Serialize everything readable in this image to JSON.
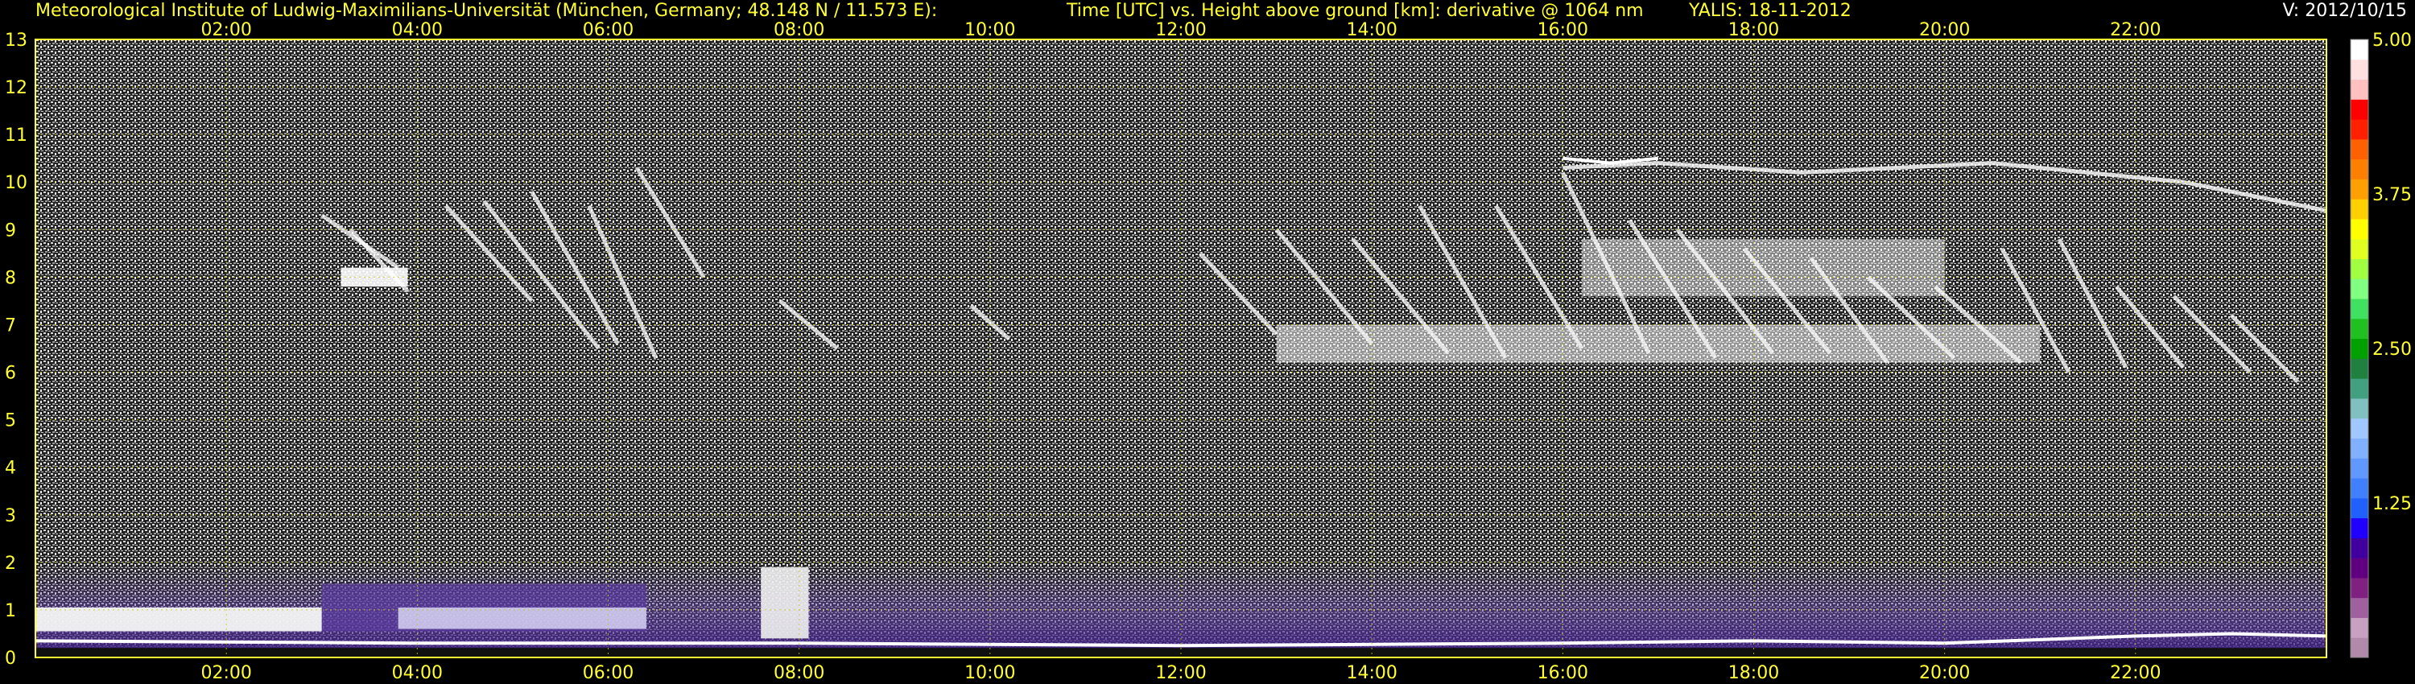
{
  "header": {
    "institute": "Meteorological Institute of Ludwig-Maximilians-Universität (München, Germany; 48.148 N / 11.573 E):",
    "axes_desc": "Time [UTC] vs. Height above ground [km]: derivative @ 1064 nm",
    "station_date": "YALIS: 18-11-2012",
    "version": "V: 2012/10/15"
  },
  "chart_data": {
    "type": "heatmap",
    "x_ticks": [
      "02:00",
      "04:00",
      "06:00",
      "08:00",
      "10:00",
      "12:00",
      "14:00",
      "16:00",
      "18:00",
      "20:00",
      "22:00"
    ],
    "x_range_hours": [
      0,
      24
    ],
    "y_ticks": [
      "0",
      "1",
      "2",
      "3",
      "4",
      "5",
      "6",
      "7",
      "8",
      "9",
      "10",
      "11",
      "12",
      "13"
    ],
    "y_range_km": [
      0,
      13
    ],
    "colorbar": {
      "ticks": [
        "1.25",
        "2.50",
        "3.75",
        "5.00"
      ],
      "range": [
        0,
        5
      ],
      "colors": [
        "#b08aa8",
        "#c8a0c0",
        "#a060a0",
        "#802080",
        "#600080",
        "#4000a0",
        "#2000ff",
        "#2060ff",
        "#4080ff",
        "#6098ff",
        "#80b0ff",
        "#a0c8ff",
        "#80c0c0",
        "#40a080",
        "#208040",
        "#00a000",
        "#20c020",
        "#40e060",
        "#80ff80",
        "#a0ff40",
        "#e0ff20",
        "#ffff00",
        "#ffd000",
        "#ffa000",
        "#ff8000",
        "#ff6000",
        "#ff2000",
        "#ff0000",
        "#ffc0c0",
        "#ffe0e0",
        "#ffffff"
      ]
    },
    "grid": true,
    "features": {
      "boundary_layer_top_km": 2.0,
      "low_cloud_layer_km": [
        0.5,
        1.5
      ],
      "low_cloud_hours": [
        0.0,
        8.0
      ],
      "cirrus_base_km": 6.0,
      "cirrus_top_km": 10.5,
      "cirrus_hours": [
        2.5,
        24.0
      ]
    }
  }
}
